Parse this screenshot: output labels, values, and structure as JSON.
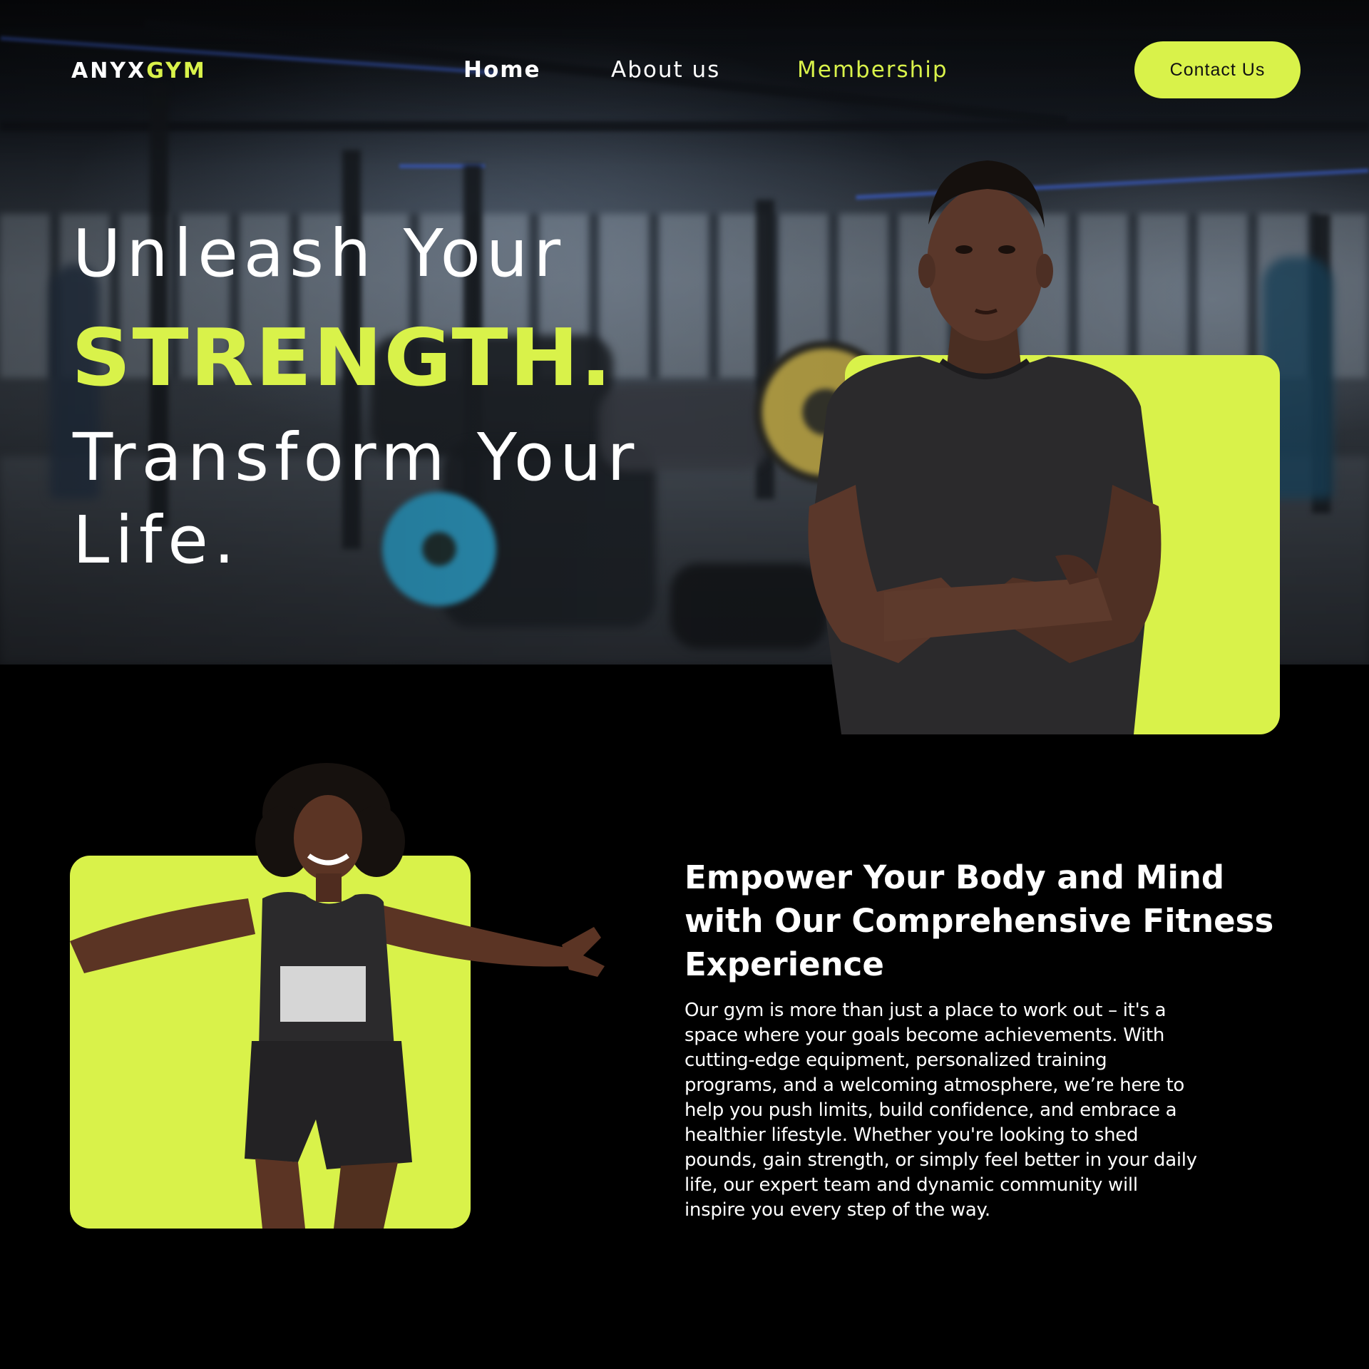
{
  "nav": {
    "logo_part1": "ANYX",
    "logo_part2": "GYM",
    "links": [
      {
        "label": "Home",
        "active": true
      },
      {
        "label": "About us",
        "active": false
      },
      {
        "label": "Membership",
        "active": false,
        "highlighted": true
      }
    ],
    "contact_button": "Contact Us"
  },
  "hero": {
    "line1": "Unleash Your",
    "highlight": "STRENGTH.",
    "line2": "Transform Your",
    "line3": "Life."
  },
  "about": {
    "title": "Empower Your Body and Mind with Our Comprehensive Fitness Experience",
    "body": "Our gym is more than just a place to work out – it's a space where your goals become achievements. With cutting-edge equipment, personalized training programs, and a welcoming atmosphere, we’re here to help you push limits, build confidence, and embrace a healthier lifestyle. Whether you're looking to shed pounds, gain strength, or simply feel better in your daily life, our expert team and dynamic community will inspire you every step of the way."
  },
  "colors": {
    "accent": "#d9f24a",
    "background": "#000000",
    "text": "#ffffff"
  }
}
